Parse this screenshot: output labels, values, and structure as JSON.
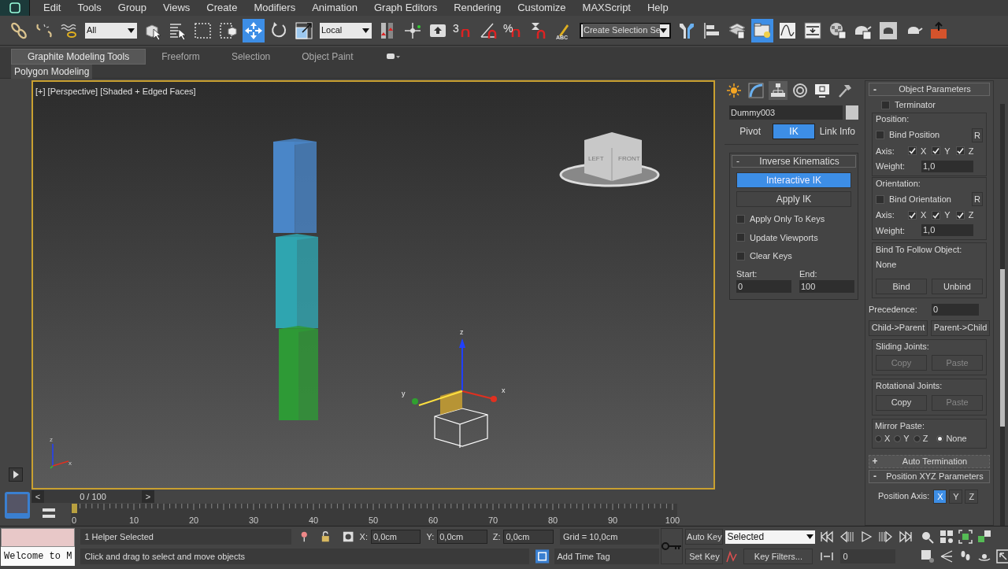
{
  "menu_bar": {
    "items": [
      "Edit",
      "Tools",
      "Group",
      "Views",
      "Create",
      "Modifiers",
      "Animation",
      "Graph Editors",
      "Rendering",
      "Customize",
      "MAXScript",
      "Help"
    ]
  },
  "main_toolbar": {
    "items": [
      {
        "kind": "link",
        "active": false
      },
      {
        "kind": "unlink",
        "active": false
      },
      {
        "kind": "bind_spacewarp",
        "active": false
      },
      {
        "kind": "dropdown",
        "value": "All"
      },
      {
        "kind": "select_object",
        "active": false
      },
      {
        "kind": "select_by_name",
        "active": false
      },
      {
        "kind": "rect_region",
        "active": false
      },
      {
        "kind": "window_crossing",
        "active": false
      },
      {
        "kind": "move",
        "active": true
      },
      {
        "kind": "rotate",
        "active": false
      },
      {
        "kind": "scale",
        "active": false
      },
      {
        "kind": "dropdown",
        "value": "Local"
      },
      {
        "kind": "pivot",
        "active": false
      },
      {
        "kind": "manipulate",
        "active": false
      },
      {
        "kind": "keyboard",
        "active": false
      },
      {
        "kind": "snap",
        "label": "3",
        "active": false
      },
      {
        "kind": "angle_snap",
        "active": false
      },
      {
        "kind": "percent_snap",
        "label": "%",
        "active": false
      },
      {
        "kind": "spinner_snap",
        "active": false
      },
      {
        "kind": "named_sets",
        "label": "ABC",
        "active": false
      },
      {
        "kind": "named_field",
        "value": "Create Selection Se"
      },
      {
        "kind": "mirror",
        "active": false
      },
      {
        "kind": "align",
        "active": false
      },
      {
        "kind": "layers",
        "active": false
      },
      {
        "kind": "scene_explorer",
        "active": true
      },
      {
        "kind": "curve_editor",
        "active": false
      },
      {
        "kind": "schematic",
        "active": false
      },
      {
        "kind": "material_editor",
        "active": false
      },
      {
        "kind": "render_setup",
        "active": false
      },
      {
        "kind": "rendered_frame",
        "active": false
      },
      {
        "kind": "render",
        "active": false
      },
      {
        "kind": "container",
        "active": false
      }
    ]
  },
  "ribbon": {
    "tabs": [
      {
        "label": "Graphite Modeling Tools",
        "selected": true
      },
      {
        "label": "Freeform",
        "selected": false
      },
      {
        "label": "Selection",
        "selected": false
      },
      {
        "label": "Object Paint",
        "selected": false
      }
    ],
    "panel_label": "Polygon Modeling"
  },
  "viewport": {
    "label": "[+] [Perspective] [Shaded + Edged Faces]",
    "active": true,
    "viewcube_faces": [
      "LEFT",
      "FRONT"
    ],
    "objects": [
      {
        "color": "#4a86c8"
      },
      {
        "color": "#2fa5b0"
      },
      {
        "color": "#2e9a36"
      }
    ],
    "gizmo_axes": [
      "z",
      "y",
      "x"
    ],
    "world_axes": [
      "z",
      "x"
    ]
  },
  "command_panel": {
    "tabs": [
      {
        "kind": "create",
        "selected": false
      },
      {
        "kind": "modify",
        "selected": false
      },
      {
        "kind": "hierarchy",
        "selected": true
      },
      {
        "kind": "motion",
        "selected": false
      },
      {
        "kind": "display",
        "selected": false
      },
      {
        "kind": "utilities",
        "selected": false
      }
    ],
    "object_name": "Dummy003",
    "subtabs": [
      {
        "label": "Pivot",
        "selected": false
      },
      {
        "label": "IK",
        "selected": true
      },
      {
        "label": "Link Info",
        "selected": false
      }
    ],
    "ik_rollout": {
      "toggle": "-",
      "title": "Inverse Kinematics",
      "buttons": [
        {
          "label": "Interactive IK",
          "active": true
        },
        {
          "label": "Apply IK",
          "active": false
        }
      ],
      "options": [
        {
          "label": "Apply Only To Keys",
          "checked": false
        },
        {
          "label": "Update Viewports",
          "checked": false
        },
        {
          "label": "Clear Keys",
          "checked": false
        }
      ],
      "start": {
        "label": "Start:",
        "value": "0"
      },
      "end": {
        "label": "End:",
        "value": "100"
      }
    },
    "object_parameters": {
      "toggle": "-",
      "title": "Object Parameters",
      "terminator": {
        "label": "Terminator",
        "checked": false
      },
      "groups": [
        {
          "title": "Position:",
          "bind": {
            "label": "Bind Position",
            "checked": false
          },
          "reset": "R",
          "axis_label": "Axis:",
          "axes": [
            {
              "label": "X",
              "checked": true
            },
            {
              "label": "Y",
              "checked": true
            },
            {
              "label": "Z",
              "checked": true
            }
          ],
          "weight_label": "Weight:",
          "weight": "1,0"
        },
        {
          "title": "Orientation:",
          "bind": {
            "label": "Bind Orientation",
            "checked": false
          },
          "reset": "R",
          "axis_label": "Axis:",
          "axes": [
            {
              "label": "X",
              "checked": true
            },
            {
              "label": "Y",
              "checked": true
            },
            {
              "label": "Z",
              "checked": true
            }
          ],
          "weight_label": "Weight:",
          "weight": "1,0"
        }
      ],
      "follow": {
        "title": "Bind To Follow Object:",
        "target": "None",
        "buttons": [
          "Bind",
          "Unbind"
        ]
      },
      "precedence": {
        "label": "Precedence:",
        "value": "0"
      },
      "order_buttons": [
        "Child->Parent",
        "Parent->Child"
      ],
      "joints": [
        {
          "title": "Sliding Joints:",
          "buttons": [
            {
              "label": "Copy",
              "disabled": true
            },
            {
              "label": "Paste",
              "disabled": true
            }
          ]
        },
        {
          "title": "Rotational Joints:",
          "buttons": [
            {
              "label": "Copy",
              "disabled": false
            },
            {
              "label": "Paste",
              "disabled": true
            }
          ]
        }
      ],
      "mirror": {
        "title": "Mirror Paste:",
        "options": [
          {
            "label": "X",
            "selected": false
          },
          {
            "label": "Y",
            "selected": false
          },
          {
            "label": "Z",
            "selected": false
          },
          {
            "label": "None",
            "selected": true
          }
        ]
      }
    },
    "rollouts": [
      {
        "toggle": "+",
        "title": "Auto Termination",
        "expanded": false
      },
      {
        "toggle": "-",
        "title": "Position XYZ Parameters",
        "expanded": true
      }
    ],
    "position_axis": {
      "label": "Position Axis:",
      "options": [
        {
          "label": "X",
          "selected": true
        },
        {
          "label": "Y",
          "selected": false
        },
        {
          "label": "Z",
          "selected": false
        }
      ]
    }
  },
  "timeline": {
    "prev": "<",
    "label": "0 / 100",
    "next": ">",
    "ticks": [
      "0",
      "10",
      "20",
      "30",
      "40",
      "50",
      "60",
      "70",
      "80",
      "90",
      "100"
    ]
  },
  "listener": {
    "text": "Welcome to M"
  },
  "status": {
    "selection": "1 Helper Selected",
    "prompt": "Click and drag to select and move objects",
    "coords": [
      {
        "label": "X:",
        "value": "0,0cm"
      },
      {
        "label": "Y:",
        "value": "0,0cm"
      },
      {
        "label": "Z:",
        "value": "0,0cm"
      }
    ],
    "grid": "Grid = 10,0cm",
    "time_tag": "Add Time Tag"
  },
  "animation": {
    "auto_key": "Auto Key",
    "key_mode": "Selected",
    "set_key": "Set Key",
    "key_filters": "Key Filters...",
    "frame": "0"
  }
}
